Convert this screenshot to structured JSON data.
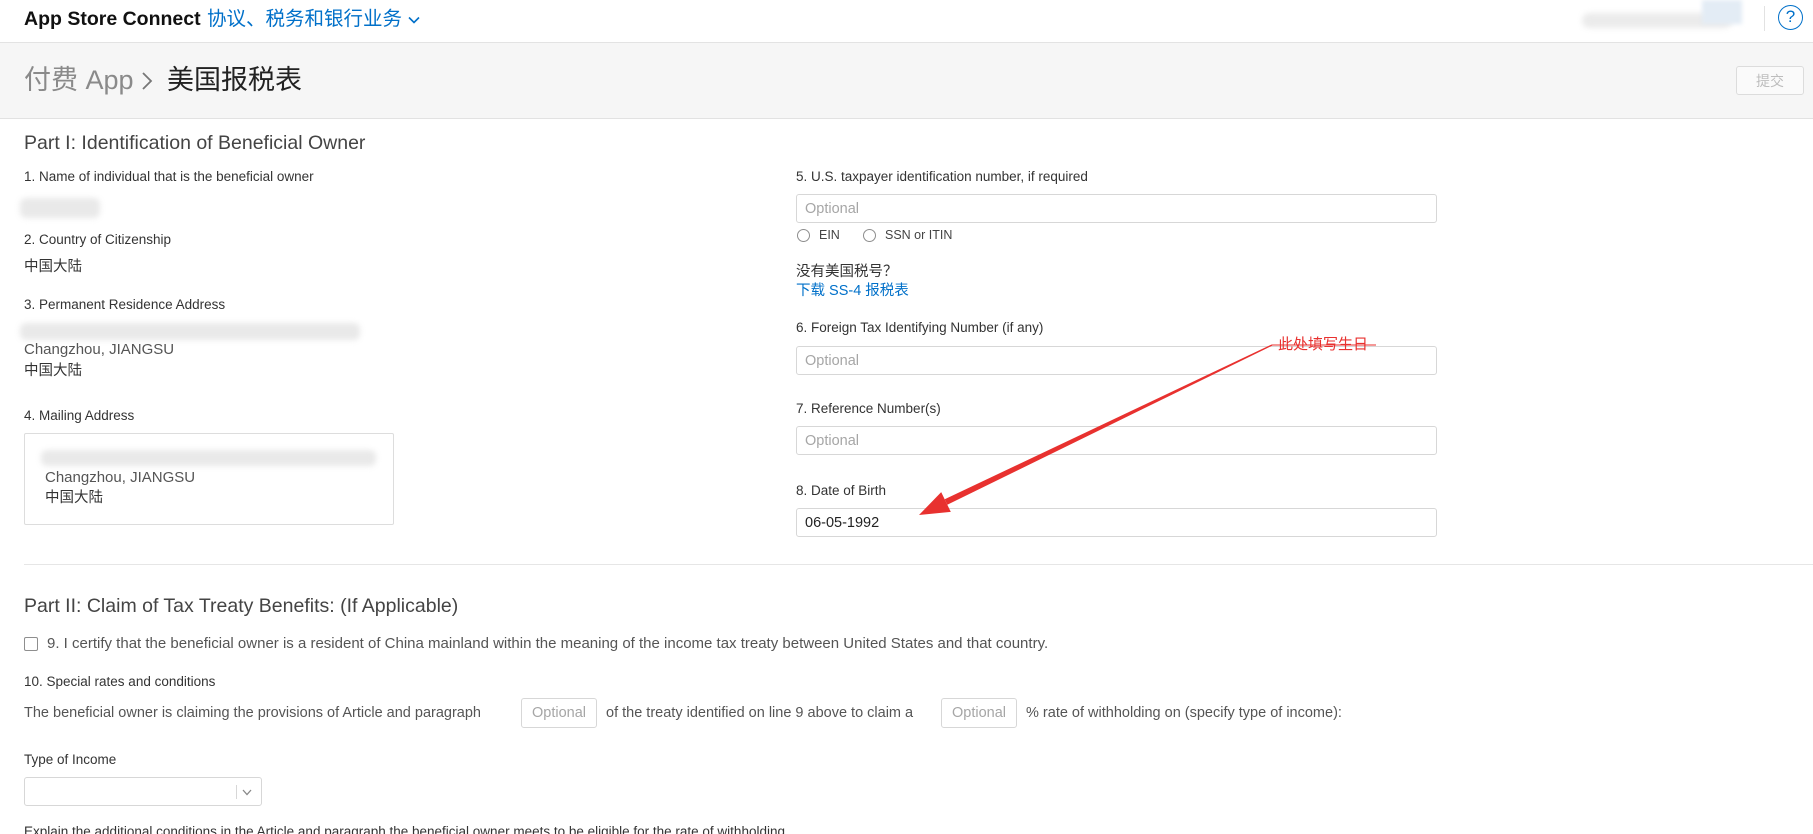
{
  "topbar": {
    "app_name": "App Store Connect",
    "section_menu": "协议、税务和银行业务",
    "help": "?"
  },
  "header": {
    "breadcrumb_parent": "付费 App",
    "breadcrumb_current": "美国报税表",
    "submit_label": "提交"
  },
  "part1": {
    "title": "Part I: Identification of Beneficial Owner",
    "field1": {
      "label": "1. Name of individual that is the beneficial owner"
    },
    "field2": {
      "label": "2. Country of Citizenship",
      "value": "中国大陆"
    },
    "field3": {
      "label": "3. Permanent Residence Address",
      "city": "Changzhou, JIANGSU",
      "country": "中国大陆"
    },
    "field4": {
      "label": "4. Mailing Address",
      "city": "Changzhou, JIANGSU",
      "country": "中国大陆"
    },
    "field5": {
      "label": "5. U.S. taxpayer identification number, if required",
      "placeholder": "Optional",
      "options": [
        "EIN",
        "SSN or ITIN"
      ]
    },
    "no_tin": {
      "question": "没有美国税号？",
      "link": "下载 SS-4 报税表"
    },
    "field6": {
      "label": "6. Foreign Tax Identifying Number (if any)",
      "placeholder": "Optional"
    },
    "field7": {
      "label": "7. Reference Number(s)",
      "placeholder": "Optional"
    },
    "field8": {
      "label": "8. Date of Birth",
      "value": "06-05-1992"
    }
  },
  "annotation": {
    "text": "此处填写生日"
  },
  "part2": {
    "title": "Part II: Claim of Tax Treaty Benefits: (If Applicable)",
    "item9": "9. I certify that the beneficial owner is a resident of China mainland within the meaning of the income tax treaty between United States and that country.",
    "item10_label": "10. Special rates and conditions",
    "sentence_part1": "The beneficial owner is claiming the provisions of Article and paragraph",
    "article_placeholder": "Optional",
    "sentence_part2": "of the treaty identified on line 9 above to claim a",
    "rate_placeholder": "Optional",
    "sentence_part3": "% rate of withholding on (specify type of income):",
    "type_of_income_label": "Type of Income",
    "type_of_income_value": "",
    "explain_label": "Explain the additional conditions in the Article and paragraph the beneficial owner meets to be eligible for the rate of withholding"
  },
  "icons": {
    "section_menu": "chevron-down-icon",
    "breadcrumb_separator": "chevron-right-icon",
    "help": "help-icon",
    "select": "chevron-down-icon"
  },
  "colors": {
    "accent": "#0070c9",
    "annotation": "#e8312f",
    "text": "#333333",
    "header_background": "#f6f6f6",
    "disabled_text": "#bdbdbd"
  }
}
